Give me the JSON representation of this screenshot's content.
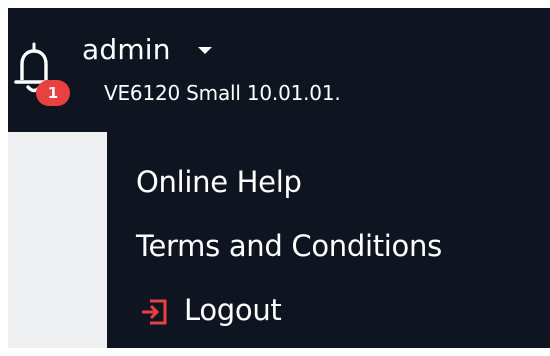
{
  "header": {
    "user_name": "admin",
    "version": "VE6120 Small 10.01.01.",
    "notifications": {
      "icon": "bell-icon",
      "count": "1",
      "badge_color": "#e8413f"
    }
  },
  "menu": {
    "items": [
      {
        "label": "Online Help"
      },
      {
        "label": "Terms and Conditions"
      }
    ],
    "logout": {
      "label": "Logout",
      "icon": "logout-icon",
      "icon_color": "#e8413f"
    }
  },
  "colors": {
    "header_bg": "#0f1520",
    "text": "#ffffff",
    "strip_bg": "#eef0f2"
  }
}
